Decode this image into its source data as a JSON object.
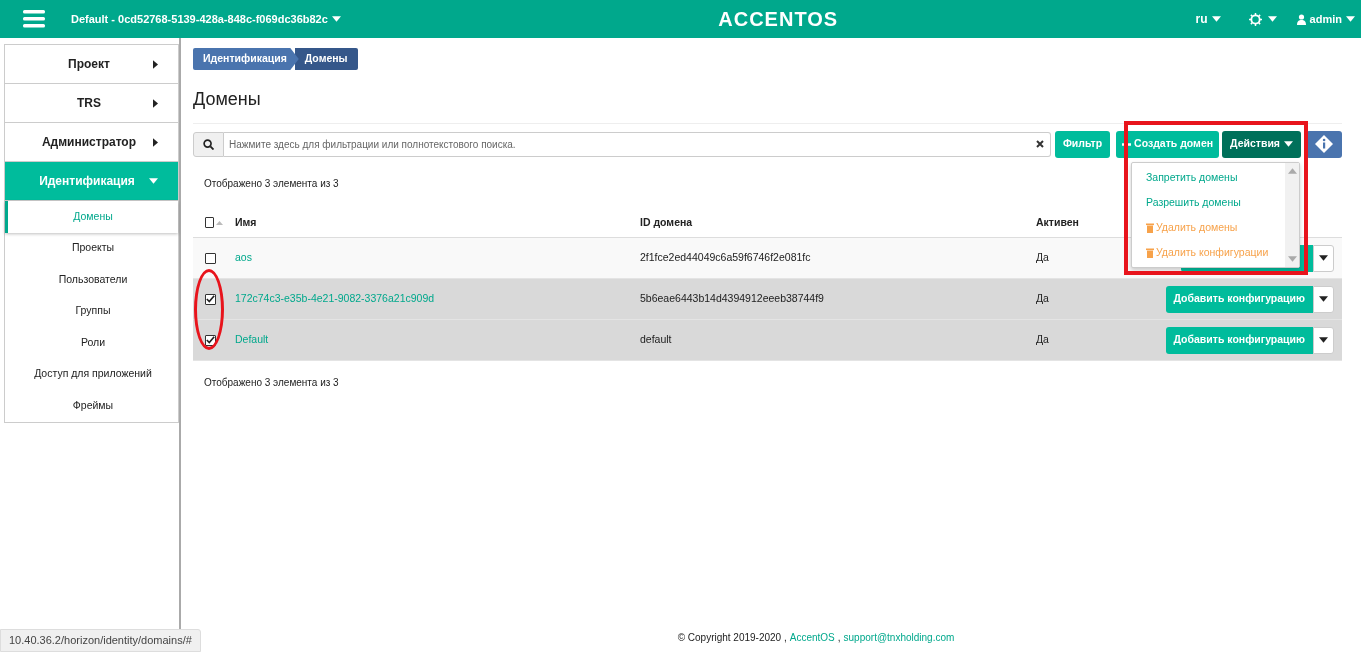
{
  "header": {
    "project": "Default - 0cd52768-5139-428a-848c-f069dc36b82c",
    "logo": "ACCENTOS",
    "language": "ru",
    "user": "admin"
  },
  "sidebar": {
    "items": [
      {
        "label": "Проект",
        "expanded": false
      },
      {
        "label": "TRS",
        "expanded": false
      },
      {
        "label": "Администратор",
        "expanded": false
      },
      {
        "label": "Идентификация",
        "expanded": true,
        "children": [
          {
            "label": "Домены",
            "selected": true
          },
          {
            "label": "Проекты",
            "selected": false
          },
          {
            "label": "Пользователи",
            "selected": false
          },
          {
            "label": "Группы",
            "selected": false
          },
          {
            "label": "Роли",
            "selected": false
          },
          {
            "label": "Доступ для приложений",
            "selected": false
          },
          {
            "label": "Фреймы",
            "selected": false
          }
        ]
      }
    ]
  },
  "breadcrumb": [
    "Идентификация",
    "Домены"
  ],
  "page_title": "Домены",
  "search": {
    "placeholder": "Нажмите здесь для фильтрации или полнотекстового поиска."
  },
  "toolbar": {
    "filter": "Фильтр",
    "create": "Создать домен",
    "actions": "Действия"
  },
  "actions_menu": [
    {
      "label": "Запретить домены",
      "kind": "normal"
    },
    {
      "label": "Разрешить домены",
      "kind": "normal"
    },
    {
      "label": "Удалить домены",
      "kind": "danger"
    },
    {
      "label": "Удалить конфигурации",
      "kind": "danger"
    }
  ],
  "summary_top": "Отображено 3 элемента из 3",
  "table": {
    "select_all": false,
    "columns": [
      "Имя",
      "ID домена",
      "Активен"
    ],
    "rows": [
      {
        "name": "aos",
        "id": "2f1fce2ed44049c6a59f6746f2e081fc",
        "active": "Да",
        "selected": false
      },
      {
        "name": "172c74c3-e35b-4e21-9082-3376a21c909d",
        "id": "5b6eae6443b14d4394912eeeb38744f9",
        "active": "Да",
        "selected": true,
        "action": "Добавить конфигурацию"
      },
      {
        "name": "Default",
        "id": "default",
        "active": "Да",
        "selected": true,
        "action": "Добавить конфигурацию"
      }
    ]
  },
  "summary_bottom": "Отображено 3 элемента из 3",
  "footer": {
    "copyright": "© Copyright 2019-2020 ,",
    "brand": "AccentOS",
    "separator": ",",
    "email": "support@tnxholding.com"
  },
  "status_url": "10.40.36.2/horizon/identity/domains/#"
}
